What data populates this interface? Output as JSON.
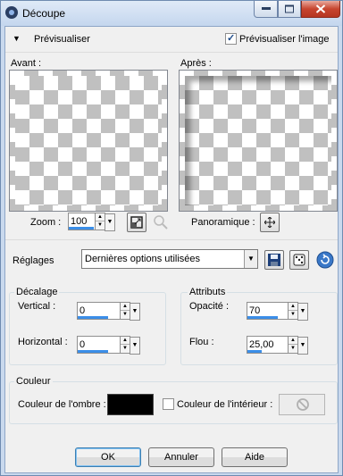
{
  "window": {
    "title": "Découpe"
  },
  "preview_section": {
    "label": "Prévisualiser",
    "checkbox_label": "Prévisualiser l'image",
    "checkbox_checked": true,
    "before_label": "Avant :",
    "after_label": "Après :",
    "zoom_label": "Zoom :",
    "zoom_value": "100",
    "pan_label": "Panoramique :"
  },
  "settings": {
    "label": "Réglages",
    "selected": "Dernières options utilisées"
  },
  "offset": {
    "group_label": "Décalage",
    "vertical_label": "Vertical :",
    "vertical_value": "0",
    "horizontal_label": "Horizontal :",
    "horizontal_value": "0"
  },
  "attributes": {
    "group_label": "Attributs",
    "opacity_label": "Opacité :",
    "opacity_value": "70",
    "blur_label": "Flou :",
    "blur_value": "25,00"
  },
  "color": {
    "group_label": "Couleur",
    "shadow_label": "Couleur de l'ombre :",
    "shadow_color": "#000000",
    "inner_checkbox_label": "Couleur de l'intérieur :",
    "inner_checked": false
  },
  "buttons": {
    "ok": "OK",
    "cancel": "Annuler",
    "help": "Aide"
  }
}
